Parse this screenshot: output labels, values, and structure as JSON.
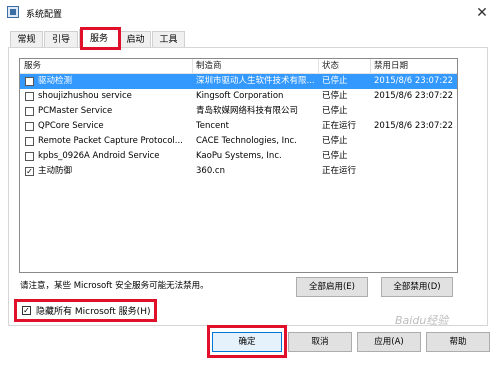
{
  "window": {
    "title": "系统配置",
    "close_glyph": "✕"
  },
  "tabs": [
    {
      "label": "常规"
    },
    {
      "label": "引导"
    },
    {
      "label": "服务"
    },
    {
      "label": "启动"
    },
    {
      "label": "工具"
    }
  ],
  "services_table": {
    "columns": [
      "服务",
      "制造商",
      "状态",
      "禁用日期"
    ],
    "rows": [
      {
        "service": "驱动检测",
        "manufacturer": "深圳市驱动人生软件技术有限...",
        "status": "已停止",
        "disabled_date": "2015/8/6 23:07:22",
        "checked": false,
        "selected": true
      },
      {
        "service": "shoujizhushou service",
        "manufacturer": "Kingsoft Corporation",
        "status": "已停止",
        "disabled_date": "2015/8/6 23:07:22",
        "checked": false,
        "selected": false
      },
      {
        "service": "PCMaster Service",
        "manufacturer": "青岛软媒网络科技有限公司",
        "status": "已停止",
        "disabled_date": "",
        "checked": false,
        "selected": false
      },
      {
        "service": "QPCore Service",
        "manufacturer": "Tencent",
        "status": "正在运行",
        "disabled_date": "2015/8/6 23:07:22",
        "checked": false,
        "selected": false
      },
      {
        "service": "Remote Packet Capture Protocol...",
        "manufacturer": "CACE Technologies, Inc.",
        "status": "已停止",
        "disabled_date": "",
        "checked": false,
        "selected": false
      },
      {
        "service": "kpbs_0926A Android Service",
        "manufacturer": "KaoPu Systems, Inc.",
        "status": "已停止",
        "disabled_date": "",
        "checked": false,
        "selected": false
      },
      {
        "service": "主动防御",
        "manufacturer": "360.cn",
        "status": "正在运行",
        "disabled_date": "",
        "checked": true,
        "selected": false
      }
    ]
  },
  "note": "请注意，某些 Microsoft 安全服务可能无法禁用。",
  "buttons": {
    "enable_all": "全部启用(E)",
    "disable_all": "全部禁用(D)",
    "ok": "确定",
    "cancel": "取消",
    "apply": "应用(A)",
    "help": "帮助"
  },
  "hide_ms_checkbox": {
    "label": "隐藏所有 Microsoft 服务(H)",
    "checked": true
  },
  "watermark": "Baidu经验"
}
